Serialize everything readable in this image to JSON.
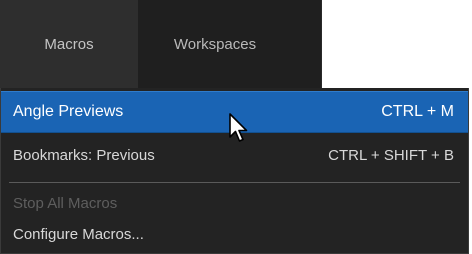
{
  "menubar": {
    "items": [
      {
        "label": "Macros"
      },
      {
        "label": "Workspaces"
      }
    ]
  },
  "dropdown": {
    "items": [
      {
        "label": "Angle Previews",
        "shortcut": "CTRL + M",
        "state": "highlighted"
      },
      {
        "label": "Bookmarks: Previous",
        "shortcut": "CTRL + SHIFT + B",
        "state": "normal"
      },
      {
        "label": "Stop All Macros",
        "shortcut": "",
        "state": "disabled"
      },
      {
        "label": "Configure Macros...",
        "shortcut": "",
        "state": "normal"
      }
    ]
  },
  "colors": {
    "menubar_bg": "#1f1f1f",
    "active_menu_bg": "#2e2e2e",
    "dropdown_bg": "#232323",
    "highlight": "#1a64b4",
    "text": "#d8d8d8",
    "disabled_text": "#5e5e5e"
  },
  "icons": {
    "cursor": "mouse-pointer-icon"
  }
}
